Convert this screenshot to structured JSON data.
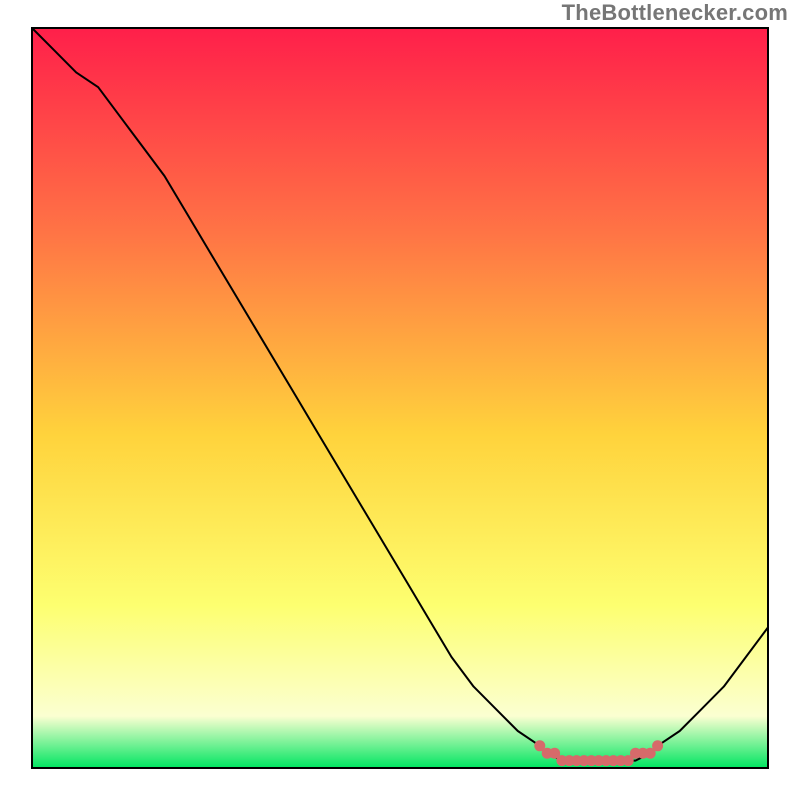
{
  "watermark": "TheBottlenecker.com",
  "colors": {
    "gradient_top": "#ff1f4a",
    "gradient_mid_upper": "#ff7545",
    "gradient_mid": "#ffd33c",
    "gradient_low": "#fdff70",
    "gradient_pale": "#fbffd1",
    "gradient_bottom": "#00e561",
    "axis": "#000000",
    "curve": "#000000",
    "plateau": "#d66a6a"
  },
  "chart_data": {
    "type": "line",
    "title": "",
    "xlabel": "",
    "ylabel": "",
    "xlim": [
      0,
      100
    ],
    "ylim": [
      0,
      100
    ],
    "x": [
      0,
      3,
      6,
      9,
      12,
      15,
      18,
      21,
      24,
      27,
      30,
      33,
      36,
      39,
      42,
      45,
      48,
      51,
      54,
      57,
      60,
      63,
      66,
      69,
      70,
      72,
      74,
      76,
      78,
      80,
      82,
      84,
      85,
      88,
      91,
      94,
      97,
      100
    ],
    "values": [
      100,
      97,
      94,
      92,
      88,
      84,
      80,
      75,
      70,
      65,
      60,
      55,
      50,
      45,
      40,
      35,
      30,
      25,
      20,
      15,
      11,
      8,
      5,
      3,
      2,
      1,
      1,
      1,
      1,
      1,
      1,
      2,
      3,
      5,
      8,
      11,
      15,
      19
    ],
    "plateau_points": {
      "x": [
        69,
        70,
        71,
        72,
        73,
        74,
        75,
        76,
        77,
        78,
        79,
        80,
        81,
        82,
        83,
        84,
        85
      ],
      "y": [
        3,
        2,
        2,
        1,
        1,
        1,
        1,
        1,
        1,
        1,
        1,
        1,
        1,
        2,
        2,
        2,
        3
      ]
    }
  }
}
